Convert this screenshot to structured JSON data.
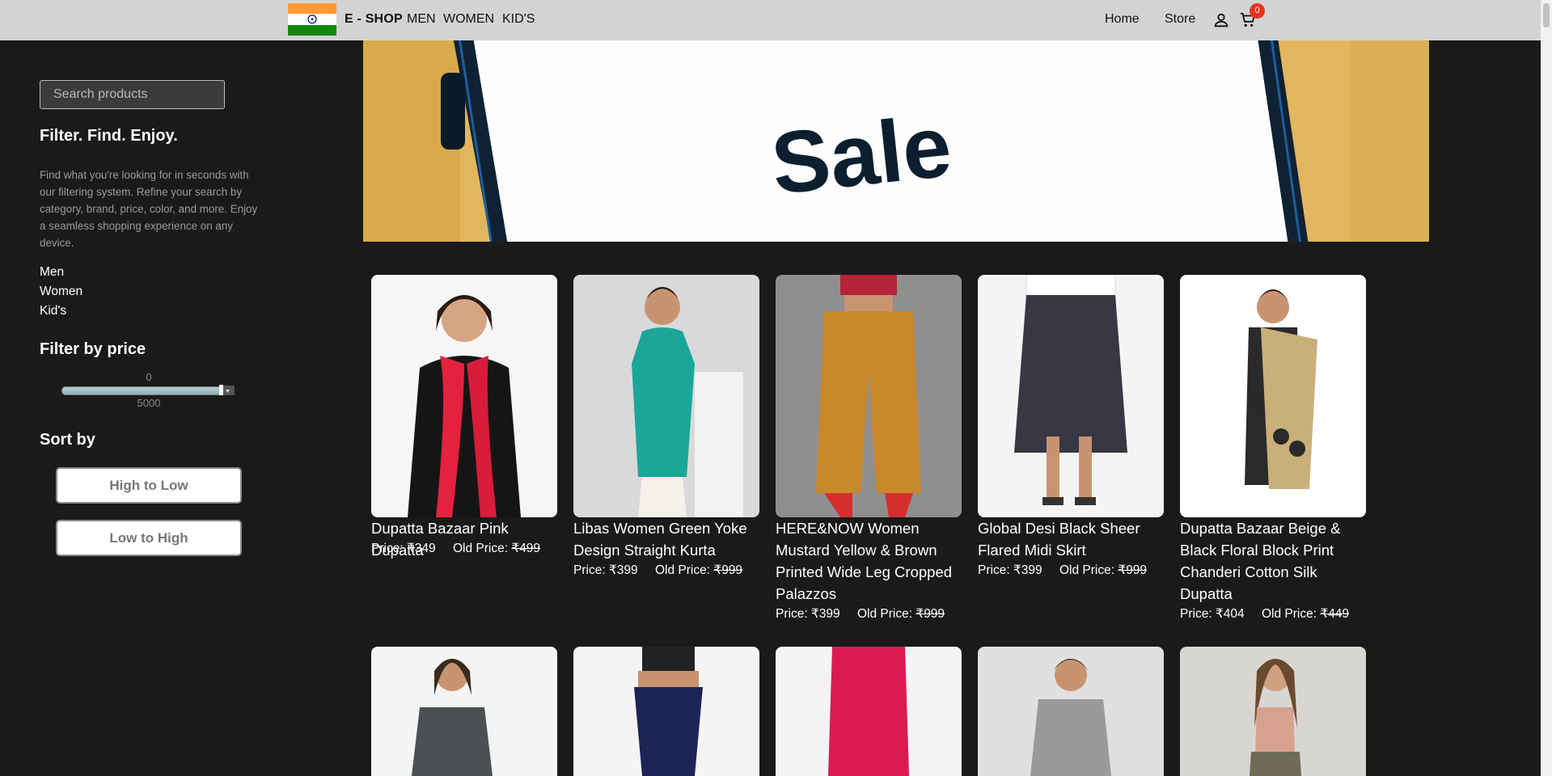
{
  "header": {
    "brand": "E - SHOP",
    "nav_left": [
      "MEN",
      "WOMEN",
      "KID'S"
    ],
    "nav_right": [
      "Home",
      "Store"
    ],
    "cart_count": "0",
    "flag_colors": [
      "#FF9933",
      "#FFFFFF",
      "#138808"
    ],
    "icons": [
      "user-icon",
      "cart-icon"
    ]
  },
  "sidebar": {
    "search_placeholder": "Search products",
    "heading": "Filter. Find. Enjoy.",
    "description": "Find what you're looking for in seconds with our filtering system. Refine your search by category, brand, price, color, and more. Enjoy a seamless shopping experience on any device.",
    "categories": [
      "Men",
      "Women",
      "Kid's"
    ],
    "price_heading": "Filter by price",
    "price_min": "0",
    "price_max": "5000",
    "price_slider_fraction": 1.0,
    "sort_heading": "Sort by",
    "sort_options": [
      "High to Low",
      "Low to High"
    ]
  },
  "banner": {
    "text": "Sale"
  },
  "products": [
    {
      "name": "Dupatta Bazaar Pink Dupatta",
      "price_label": "Price: ₹349",
      "old_label": "Old Price: ",
      "old_price": "₹499"
    },
    {
      "name": "Libas Women Green Yoke Design Straight Kurta",
      "price_label": "Price: ₹399",
      "old_label": "Old Price: ",
      "old_price": "₹999"
    },
    {
      "name": "HERE&NOW Women Mustard Yellow & Brown Printed Wide Leg Cropped Palazzos",
      "price_label": "Price: ₹399",
      "old_label": "Old Price: ",
      "old_price": "₹999"
    },
    {
      "name": "Global Desi Black Sheer Flared Midi Skirt",
      "price_label": "Price: ₹399",
      "old_label": "Old Price: ",
      "old_price": "₹999"
    },
    {
      "name": "Dupatta Bazaar Beige & Black Floral Block Print Chanderi Cotton Silk Dupatta",
      "price_label": "Price: ₹404",
      "old_label": "Old Price: ",
      "old_price": "₹449"
    }
  ]
}
